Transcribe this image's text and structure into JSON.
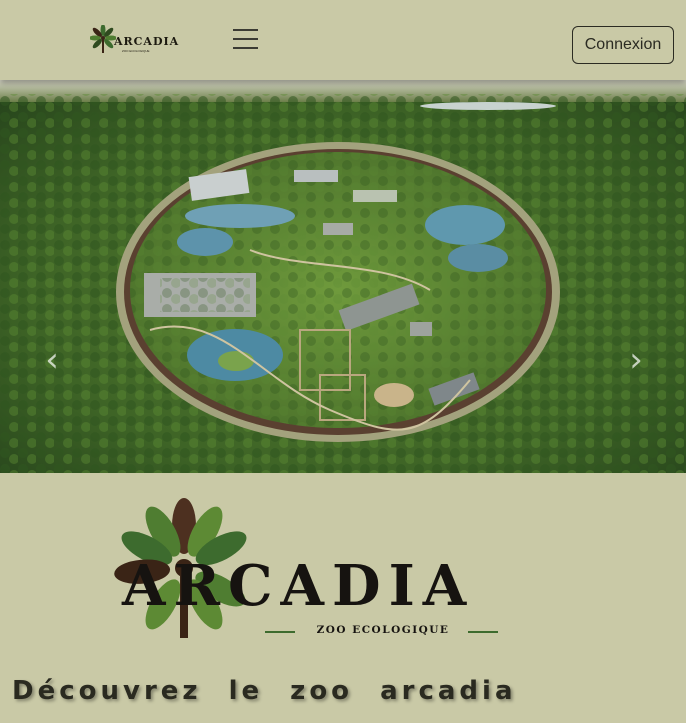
{
  "nav": {
    "logo_text": "ARCADIA",
    "logo_sub": "ZOO ECOLOGIQUE",
    "menu_icon": "hamburger-menu-icon",
    "login_label": "Connexion"
  },
  "carousel": {
    "image": "aerial-view-of-zoo-in-forest",
    "prev_icon": "chevron-left-icon",
    "next_icon": "chevron-right-icon"
  },
  "hero": {
    "logo_title": "ARCADIA",
    "logo_subtitle": "ZOO ECOLOGIQUE",
    "heading": "Découvrez le zoo arcadia"
  },
  "colors": {
    "background": "#c9c9a6",
    "forest_green": "#3d6b2e",
    "dark_text": "#161310"
  }
}
